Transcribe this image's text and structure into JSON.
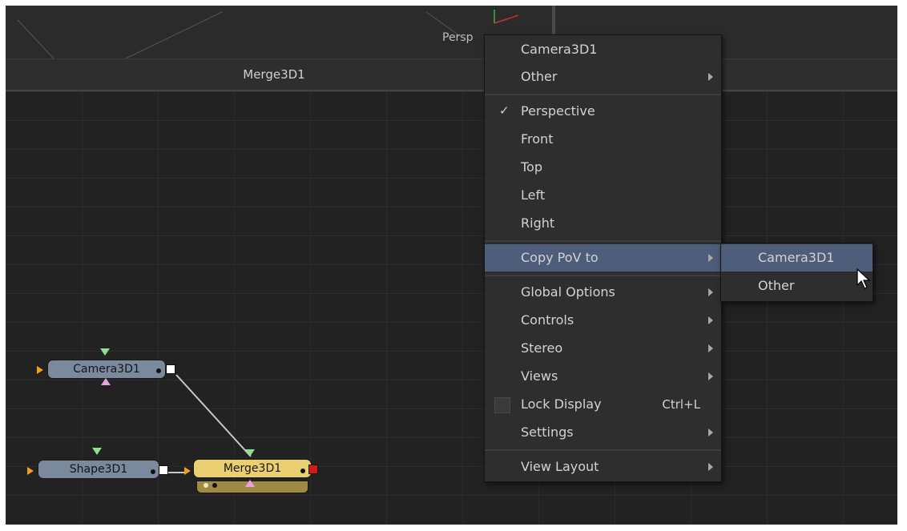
{
  "viewport": {
    "label": "Persp"
  },
  "flow": {
    "title": "Merge3D1",
    "nodes": {
      "camera": "Camera3D1",
      "shape": "Shape3D1",
      "merge": "Merge3D1"
    }
  },
  "menu": {
    "items": [
      {
        "label": "Camera3D1"
      },
      {
        "label": "Other"
      },
      {
        "label": "Perspective",
        "check": "✓"
      },
      {
        "label": "Front"
      },
      {
        "label": "Top"
      },
      {
        "label": "Left"
      },
      {
        "label": "Right"
      },
      {
        "label": "Copy PoV to"
      },
      {
        "label": "Global Options"
      },
      {
        "label": "Controls"
      },
      {
        "label": "Stereo"
      },
      {
        "label": "Views"
      },
      {
        "label": "Lock Display",
        "shortcut": "Ctrl+L"
      },
      {
        "label": "Settings"
      },
      {
        "label": "View Layout"
      }
    ]
  },
  "submenu": {
    "items": [
      {
        "label": "Camera3D1"
      },
      {
        "label": "Other"
      }
    ]
  },
  "colors": {
    "highlight": "#4e5d7a",
    "node_blue": "#7a8a9c",
    "node_yellow": "#eacf72",
    "output_red": "#d31a1a"
  },
  "icons": [
    "check-icon",
    "submenu-arrow-icon",
    "mouse-pointer-icon",
    "input-triangle-icon",
    "output-square-icon"
  ]
}
